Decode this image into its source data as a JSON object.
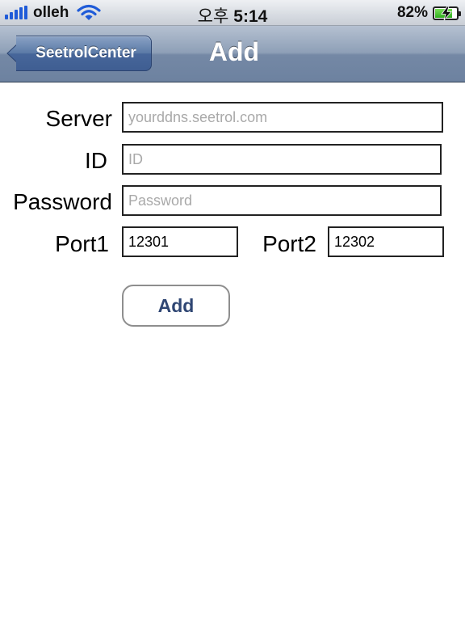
{
  "status_bar": {
    "carrier": "olleh",
    "time_prefix": "오후",
    "time": "5:14",
    "battery_percent": "82%",
    "battery_level": 0.82,
    "icons": [
      "signal-bars-icon",
      "wifi-icon",
      "battery-charging-icon"
    ]
  },
  "nav": {
    "back_label": "SeetrolCenter",
    "title": "Add"
  },
  "form": {
    "server": {
      "label": "Server",
      "placeholder": "yourddns.seetrol.com",
      "value": ""
    },
    "id": {
      "label": "ID",
      "placeholder": "ID",
      "value": ""
    },
    "password": {
      "label": "Password",
      "placeholder": "Password",
      "value": ""
    },
    "port1": {
      "label": "Port1",
      "value": "12301"
    },
    "port2": {
      "label": "Port2",
      "value": "12302"
    },
    "submit_label": "Add"
  },
  "colors": {
    "nav_bar": "#7f93af",
    "back_button": "#4e6d9d",
    "submit_text": "#2f4673",
    "placeholder": "#a9a9a9"
  }
}
